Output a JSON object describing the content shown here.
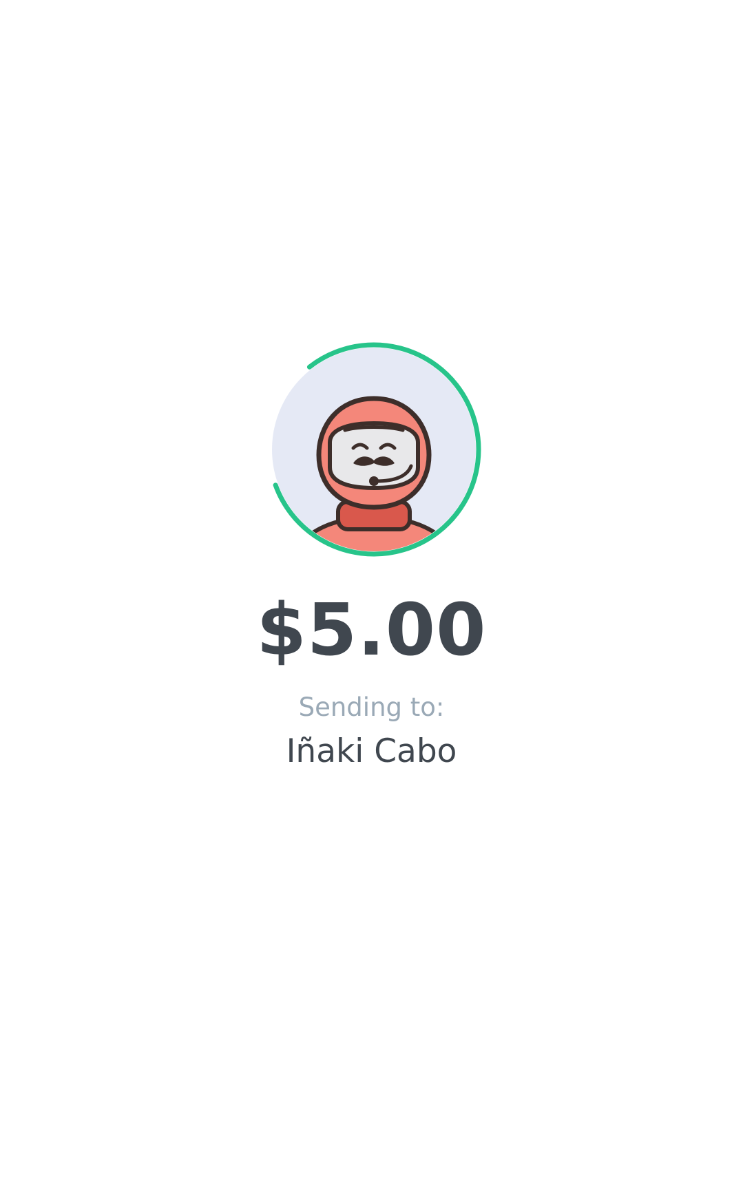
{
  "payment": {
    "amount": "$5.00",
    "sending_label": "Sending to:",
    "recipient_name": "Iñaki Cabo"
  },
  "progress_ring": {
    "fraction": 0.8,
    "color": "#27c48a"
  },
  "avatar": {
    "icon": "astronaut-avatar-icon",
    "background_color": "#e5e9f5",
    "helmet_color": "#f4877a",
    "outline_color": "#3d2e2a"
  }
}
